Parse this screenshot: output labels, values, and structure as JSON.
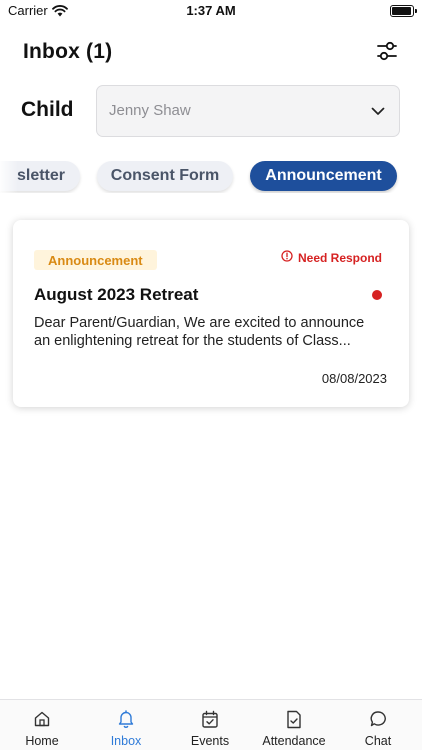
{
  "status_bar": {
    "carrier": "Carrier",
    "time": "1:37 AM"
  },
  "header": {
    "title": "Inbox (1)"
  },
  "child_selector": {
    "label": "Child",
    "value": "Jenny Shaw"
  },
  "chips": [
    {
      "label": "Newsletter",
      "visible_text": "sletter",
      "active": false
    },
    {
      "label": "Consent Form",
      "active": false
    },
    {
      "label": "Announcement",
      "active": true
    }
  ],
  "messages": [
    {
      "category": "Announcement",
      "status": "Need Respond",
      "title": "August 2023 Retreat",
      "preview": "Dear Parent/Guardian, We are excited to announce an enlightening retreat for the students of Class...",
      "date": "08/08/2023",
      "unread": true
    }
  ],
  "tabs": [
    {
      "label": "Home",
      "icon": "home-icon",
      "active": false
    },
    {
      "label": "Inbox",
      "icon": "bell-icon",
      "active": true
    },
    {
      "label": "Events",
      "icon": "calendar-icon",
      "active": false
    },
    {
      "label": "Attendance",
      "icon": "attendance-icon",
      "active": false
    },
    {
      "label": "Chat",
      "icon": "chat-icon",
      "active": false
    }
  ],
  "colors": {
    "primary": "#1e4f9c",
    "tab_active": "#2f7bd8",
    "alert_red": "#d62222",
    "badge_bg": "#fff4dc",
    "badge_text": "#d98a14"
  }
}
